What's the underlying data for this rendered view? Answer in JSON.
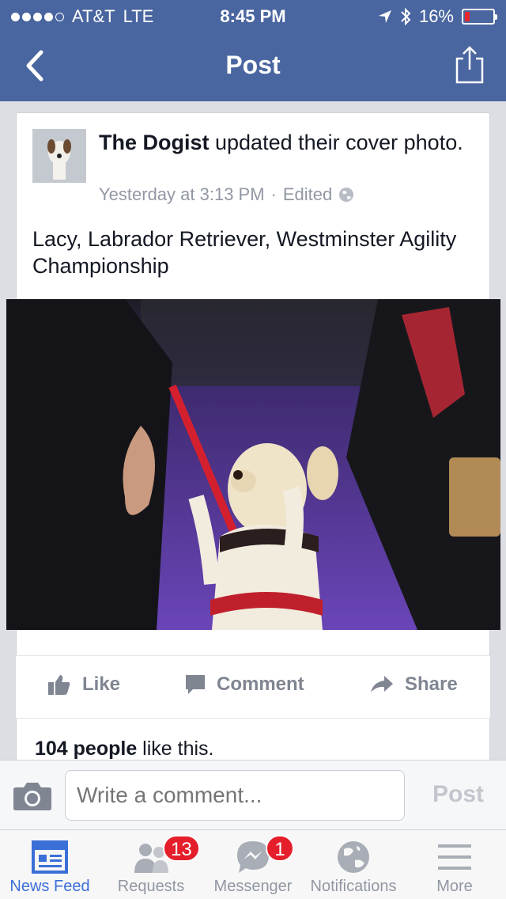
{
  "status_bar": {
    "carrier": "AT&T",
    "network": "LTE",
    "time": "8:45 PM",
    "battery": "16%",
    "battery_level": 0.16,
    "signal_bars": 4
  },
  "nav": {
    "title": "Post"
  },
  "post": {
    "author": "The Dogist",
    "action": " updated their cover photo.",
    "timestamp": "Yesterday at 3:13 PM",
    "separator": "·",
    "edited": "Edited",
    "text": "Lacy, Labrador Retriever, Westminster Agility Championship",
    "actions": {
      "like": "Like",
      "comment": "Comment",
      "share": "Share"
    },
    "likes_count": "104 people",
    "likes_suffix": " like this."
  },
  "comment_bar": {
    "placeholder": "Write a comment...",
    "post_label": "Post"
  },
  "tabs": [
    {
      "label": "News Feed",
      "icon": "news-feed-icon"
    },
    {
      "label": "Requests",
      "icon": "friend-requests-icon",
      "badge": "13"
    },
    {
      "label": "Messenger",
      "icon": "messenger-icon",
      "badge": "1"
    },
    {
      "label": "Notifications",
      "icon": "globe-icon"
    },
    {
      "label": "More",
      "icon": "menu-icon"
    }
  ],
  "colors": {
    "nav_blue": "#4a66a0",
    "active_tab": "#3b6fd8",
    "badge_red": "#e41e2a",
    "muted_text": "#9197a3"
  }
}
